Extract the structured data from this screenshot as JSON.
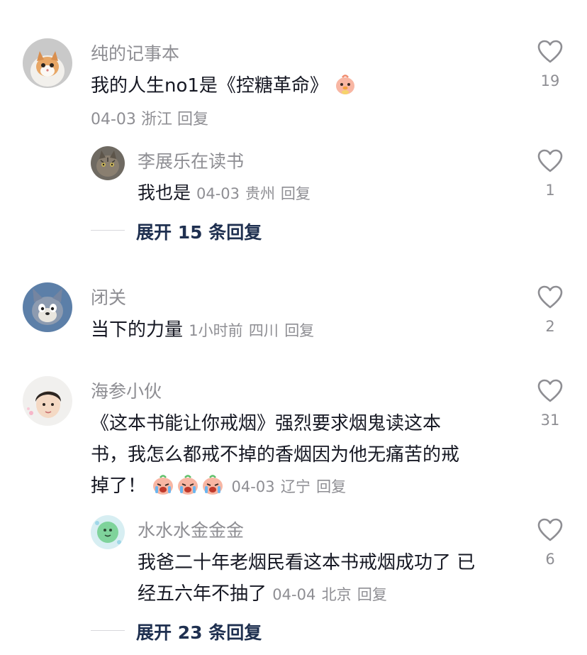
{
  "comments": [
    {
      "username": "纯的记事本",
      "text": "我的人生no1是《控糖革命》",
      "date": "04-03",
      "location": "浙江",
      "reply_label": "回复",
      "likes": "19",
      "avatar": "kitten-avatar"
    },
    {
      "username": "李展乐在读书",
      "text": "我也是",
      "date": "04-03",
      "location": "贵州",
      "reply_label": "回复",
      "likes": "1",
      "avatar": "cat-avatar"
    },
    {
      "username": "闭关",
      "text": "当下的力量",
      "date": "1小时前",
      "location": "四川",
      "reply_label": "回复",
      "likes": "2",
      "avatar": "cartoon-cat-avatar"
    },
    {
      "username": "海参小伙",
      "text_line1": "《这本书能让你戒烟》强烈要求烟鬼读这本",
      "text_line2": "书，我怎么都戒不掉的香烟因为他无痛苦的戒",
      "text_line3": "掉了！",
      "date": "04-03",
      "location": "辽宁",
      "reply_label": "回复",
      "likes": "31",
      "avatar": "child-avatar"
    },
    {
      "username": "水水水金金金",
      "text_line1": "我爸二十年老烟民看这本书戒烟成功了 已",
      "text_line2": "经五六年不抽了",
      "date": "04-04",
      "location": "北京",
      "reply_label": "回复",
      "likes": "6",
      "avatar": "green-blob-avatar"
    }
  ],
  "expand_replies": [
    {
      "label": "展开 15 条回复"
    },
    {
      "label": "展开 23 条回复"
    }
  ],
  "colors": {
    "username": "#8e8e93",
    "text": "#161823",
    "expand": "#1f3050"
  }
}
